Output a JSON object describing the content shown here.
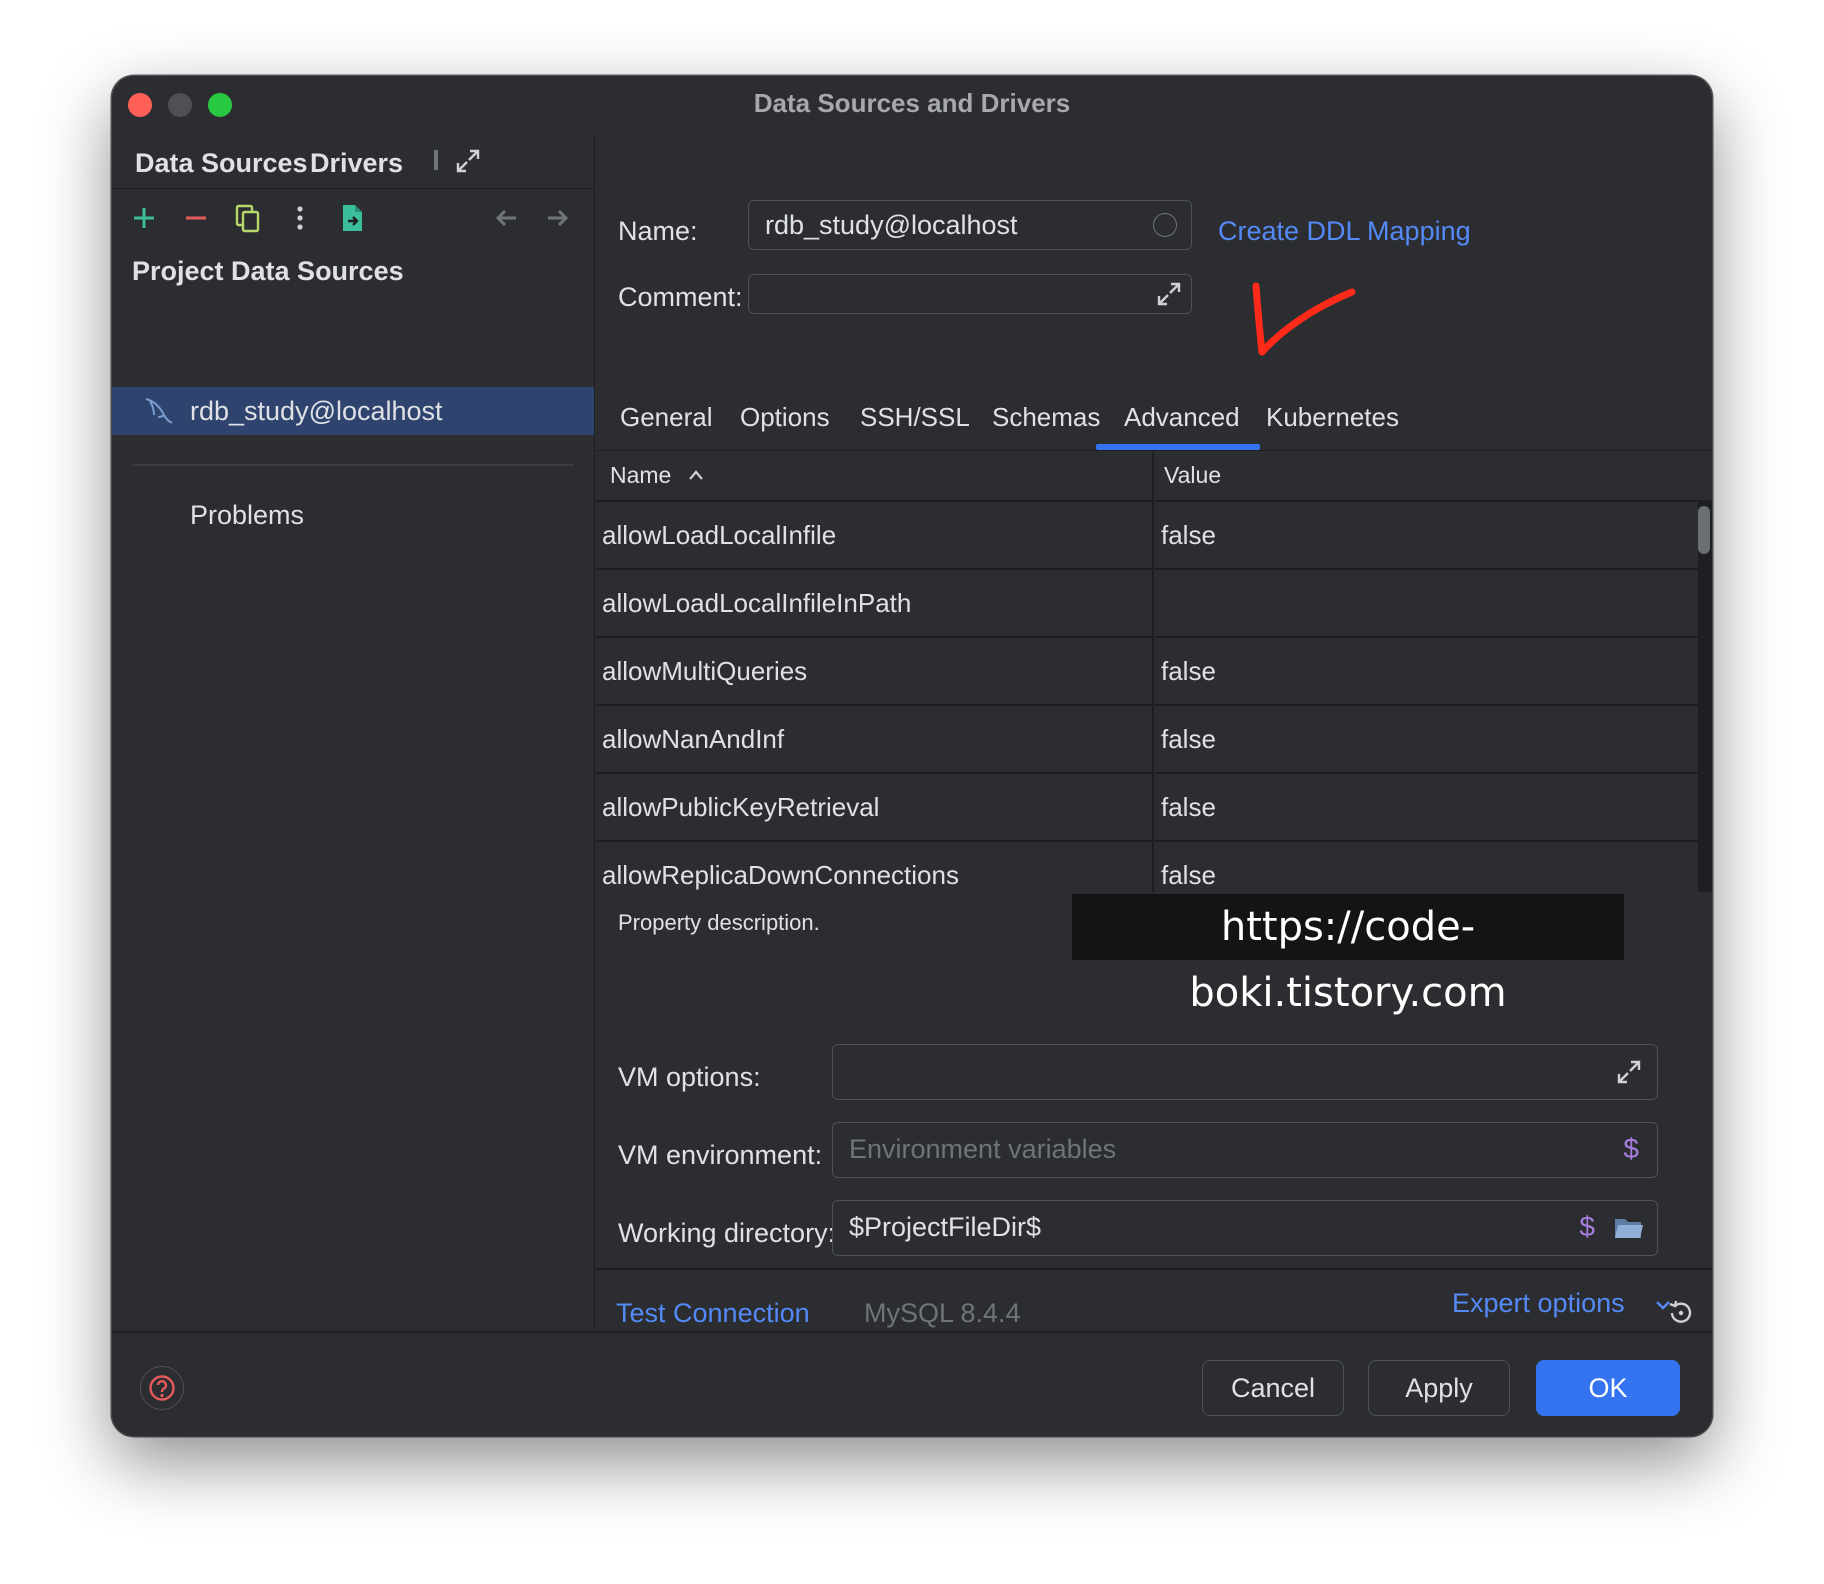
{
  "window": {
    "title": "Data Sources and Drivers"
  },
  "left": {
    "tabs": [
      {
        "label": "Data Sources",
        "active": true
      },
      {
        "label": "Drivers",
        "active": false
      }
    ],
    "section_title": "Project Data Sources",
    "items": [
      {
        "label": "rdb_study@localhost",
        "selected": true
      }
    ],
    "problems_label": "Problems"
  },
  "form": {
    "name_label": "Name:",
    "name_value": "rdb_study@localhost",
    "comment_label": "Comment:",
    "comment_value": "",
    "ddl_link": "Create DDL Mapping"
  },
  "tabs": [
    {
      "label": "General",
      "active": false
    },
    {
      "label": "Options",
      "active": false
    },
    {
      "label": "SSH/SSL",
      "active": false
    },
    {
      "label": "Schemas",
      "active": false
    },
    {
      "label": "Advanced",
      "active": true
    },
    {
      "label": "Kubernetes",
      "active": false
    }
  ],
  "table": {
    "columns": [
      "Name",
      "Value"
    ],
    "rows": [
      {
        "name": "allowLoadLocalInfile",
        "value": "false"
      },
      {
        "name": "allowLoadLocalInfileInPath",
        "value": ""
      },
      {
        "name": "allowMultiQueries",
        "value": "false"
      },
      {
        "name": "allowNanAndInf",
        "value": "false"
      },
      {
        "name": "allowPublicKeyRetrieval",
        "value": "false"
      },
      {
        "name": "allowReplicaDownConnections",
        "value": "false"
      }
    ]
  },
  "description": "Property description.",
  "watermark": "https://code-boki.tistory.com",
  "vm": {
    "options_label": "VM options:",
    "options_value": "",
    "env_label": "VM environment:",
    "env_placeholder": "Environment variables",
    "workdir_label": "Working directory:",
    "workdir_value": "$ProjectFileDir$",
    "dollar": "$"
  },
  "expert_options": "Expert options",
  "test_connection": "Test Connection",
  "driver_version": "MySQL 8.4.4",
  "buttons": {
    "cancel": "Cancel",
    "apply": "Apply",
    "ok": "OK"
  },
  "colors": {
    "accent": "#3574f0",
    "link": "#548af7",
    "background": "#2b2d30",
    "add": "#3bbf9b",
    "remove": "#e55b5b",
    "annotation": "#ff2a1a"
  }
}
